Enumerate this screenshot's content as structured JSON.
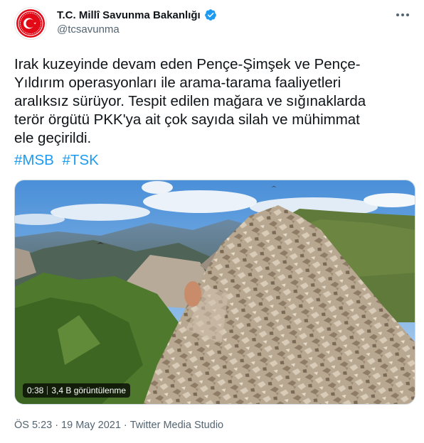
{
  "account": {
    "display_name": "T.C. Millî Savunma Bakanlığı",
    "handle": "@tcsavunma",
    "verified": true,
    "avatar_icon": "msb-emblem-icon"
  },
  "tweet": {
    "text_lines": [
      "Irak kuzeyinde devam eden Pençe-Şimşek ve Pençe-",
      "Yıldırım operasyonları ile arama-tarama faaliyetleri",
      "aralıksız sürüyor. Tespit edilen mağara ve sığınaklarda",
      "terör örgütü PKK'ya ait çok sayıda silah ve mühimmat",
      "ele geçirildi."
    ],
    "hashtags": [
      "#MSB",
      "#TSK"
    ]
  },
  "media": {
    "type": "video",
    "duration": "0:38",
    "views": "3,4 B görüntülenme"
  },
  "meta": {
    "time": "ÖS 5:23",
    "date": "19 May 2021",
    "separator": "·",
    "source": "Twitter Media Studio"
  },
  "colors": {
    "link": "#1d9bf0",
    "secondary_text": "#536471",
    "emblem_red": "#e30a17"
  }
}
